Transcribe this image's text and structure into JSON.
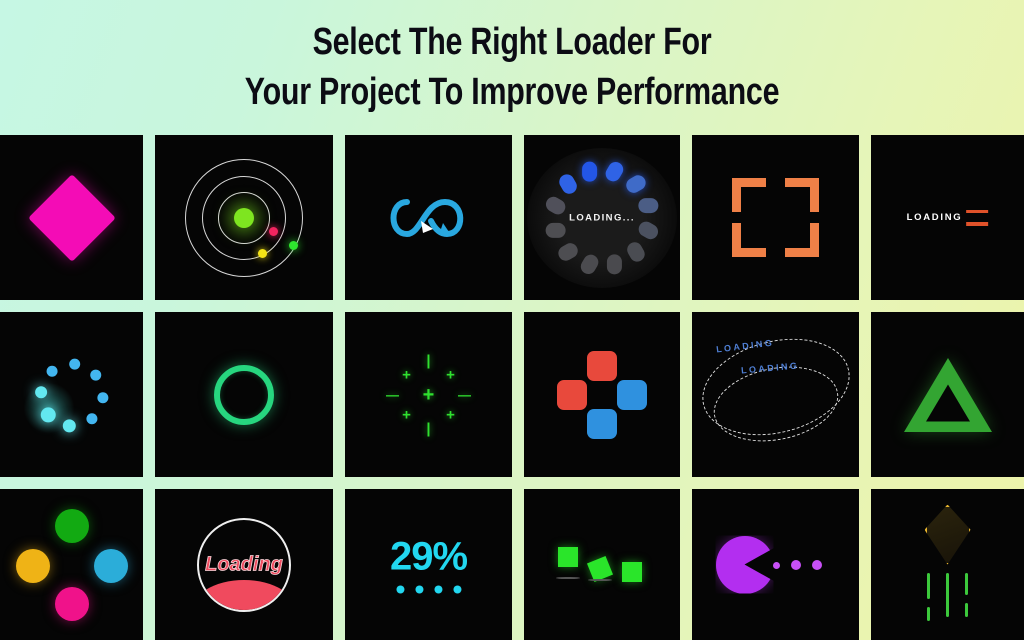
{
  "header": {
    "title": "Select The Right Loader For\nYour Project To Improve Performance",
    "line1": "Select The Right Loader For",
    "line2": "Your Project To Improve Performance"
  },
  "theme": {
    "background_gradient_start": "#c6f7e4",
    "background_gradient_end": "#eef3a8",
    "cell_background": "#050505",
    "title_color": "#0c0c14"
  },
  "grid": {
    "rows": 3,
    "columns": 6,
    "cells": [
      {
        "index": 1,
        "name": "magenta-diamond-loader",
        "row": 1,
        "col": 1,
        "label": "",
        "color": "#f40cb6"
      },
      {
        "index": 2,
        "name": "orbit-rings-loader",
        "row": 1,
        "col": 2,
        "label": "",
        "color": "#7ee520"
      },
      {
        "index": 3,
        "name": "infinity-loader",
        "row": 1,
        "col": 3,
        "label": "",
        "color": "#29a8e0"
      },
      {
        "index": 4,
        "name": "dot-circle-spinner-loader",
        "row": 1,
        "col": 4,
        "label": "LOADING...",
        "color": "#2356e8"
      },
      {
        "index": 5,
        "name": "corner-brackets-loader",
        "row": 1,
        "col": 5,
        "label": "",
        "color": "#ef8047"
      },
      {
        "index": 6,
        "name": "loading-text-bars-loader",
        "row": 1,
        "col": 6,
        "label": "LOADING",
        "color": "#e0522a"
      },
      {
        "index": 7,
        "name": "cyan-dot-ring-loader",
        "row": 2,
        "col": 1,
        "label": "",
        "color": "#43b6f0"
      },
      {
        "index": 8,
        "name": "green-ring-loader",
        "row": 2,
        "col": 2,
        "label": "",
        "color": "#27d67f"
      },
      {
        "index": 9,
        "name": "green-plus-cluster-loader",
        "row": 2,
        "col": 3,
        "label": "",
        "color": "#2fe02f"
      },
      {
        "index": 10,
        "name": "square-cluster-loader",
        "row": 2,
        "col": 4,
        "label": "",
        "color": "#e8493c"
      },
      {
        "index": 11,
        "name": "dashed-orbit-loading-loader",
        "row": 2,
        "col": 5,
        "label": "LOADING",
        "color": "#4f7fd4"
      },
      {
        "index": 12,
        "name": "green-triangle-loader",
        "row": 2,
        "col": 6,
        "label": "",
        "color": "#33a532"
      },
      {
        "index": 13,
        "name": "four-colored-dots-loader",
        "row": 3,
        "col": 1,
        "label": "",
        "color": "#12aa12"
      },
      {
        "index": 14,
        "name": "liquid-fill-circle-loader",
        "row": 3,
        "col": 2,
        "label": "Loading",
        "color": "#f04a5e"
      },
      {
        "index": 15,
        "name": "percentage-loader",
        "row": 3,
        "col": 3,
        "label": "29%",
        "color": "#22d7f0"
      },
      {
        "index": 16,
        "name": "bouncing-squares-loader",
        "row": 3,
        "col": 4,
        "label": "",
        "color": "#2ae52a"
      },
      {
        "index": 17,
        "name": "pacman-loader",
        "row": 3,
        "col": 5,
        "label": "",
        "color": "#b32ef0"
      },
      {
        "index": 18,
        "name": "gold-kite-trail-loader",
        "row": 3,
        "col": 6,
        "label": "",
        "color": "#e8b52e"
      }
    ]
  },
  "labels": {
    "loading_ellipsis": "LOADING...",
    "loading_upper": "LOADING",
    "loading_title": "Loading",
    "percent": "29%",
    "orbit_text_outer": "LOADING",
    "orbit_text_inner": "LOADING"
  }
}
